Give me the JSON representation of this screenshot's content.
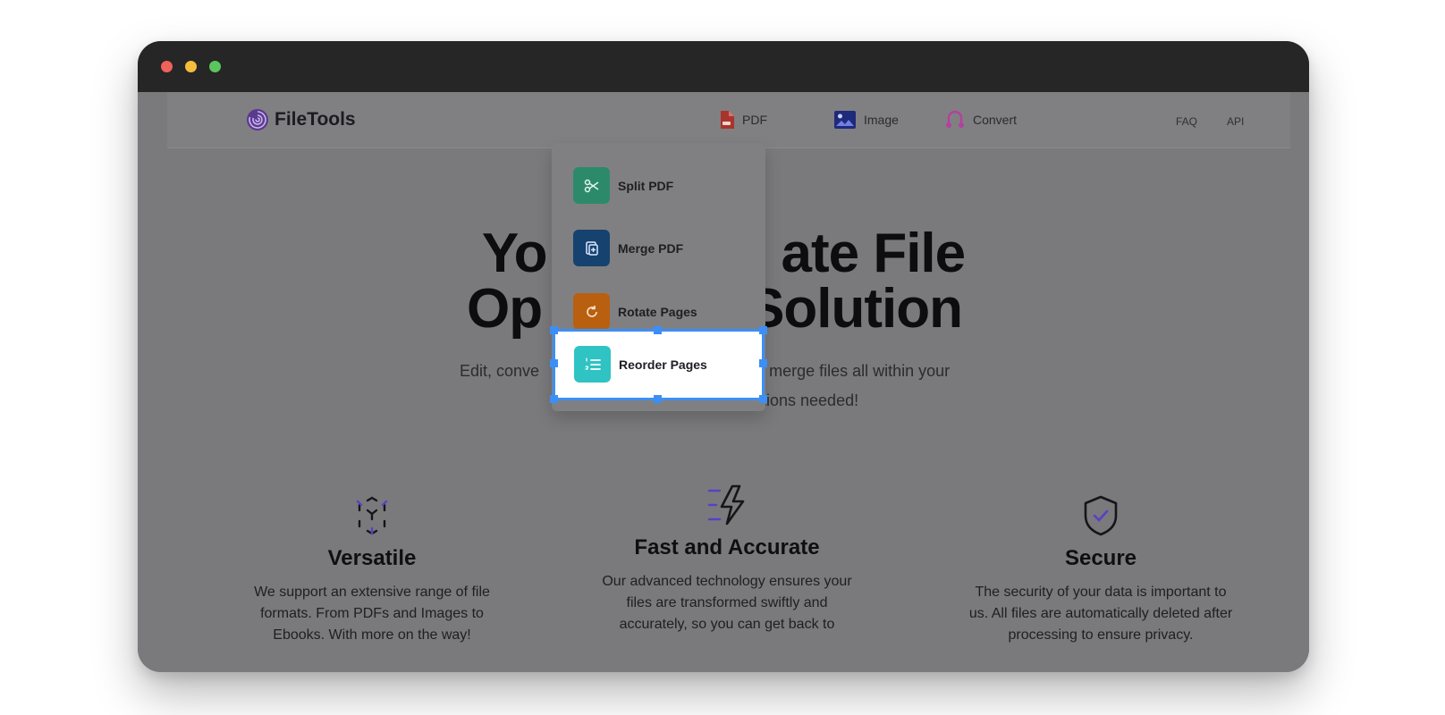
{
  "brand": {
    "name": "FileTools",
    "accent": "#7b3fe4"
  },
  "nav": {
    "pdf": "PDF",
    "image": "Image",
    "convert": "Convert",
    "faq": "FAQ",
    "api": "API"
  },
  "hero": {
    "title_line1_start": "Yo",
    "title_line1_end": "ate File",
    "title_line2_start": "Op",
    "title_line2_end": "Solution",
    "subtitle_line1_start": "Edit, conve",
    "subtitle_line1_end": "nd merge files all within your",
    "subtitle_line2_end": "tions needed!"
  },
  "pdf_menu": {
    "items": [
      {
        "label": "Split PDF",
        "icon": "scissors-icon",
        "color": "#2f9e7a"
      },
      {
        "label": "Merge PDF",
        "icon": "merge-icon",
        "color": "#1a4f8a"
      },
      {
        "label": "Rotate Pages",
        "icon": "rotate-icon",
        "color": "#cf6a13"
      },
      {
        "label": "Reorder Pages",
        "icon": "reorder-icon",
        "color": "#2fc3c3"
      }
    ],
    "selected": "Reorder Pages"
  },
  "features": [
    {
      "title": "Versatile",
      "text_lines": [
        "We support an extensive range of file",
        "formats. From PDFs and Images to",
        "Ebooks. With more on the way!"
      ]
    },
    {
      "title": "Fast and Accurate",
      "text_lines": [
        "Our advanced technology ensures your",
        "files are transformed swiftly and",
        "accurately, so you can get back to"
      ]
    },
    {
      "title": "Secure",
      "text_lines": [
        "The security of your data is important to",
        "us. All files are automatically deleted after",
        "processing to ensure privacy."
      ]
    }
  ]
}
